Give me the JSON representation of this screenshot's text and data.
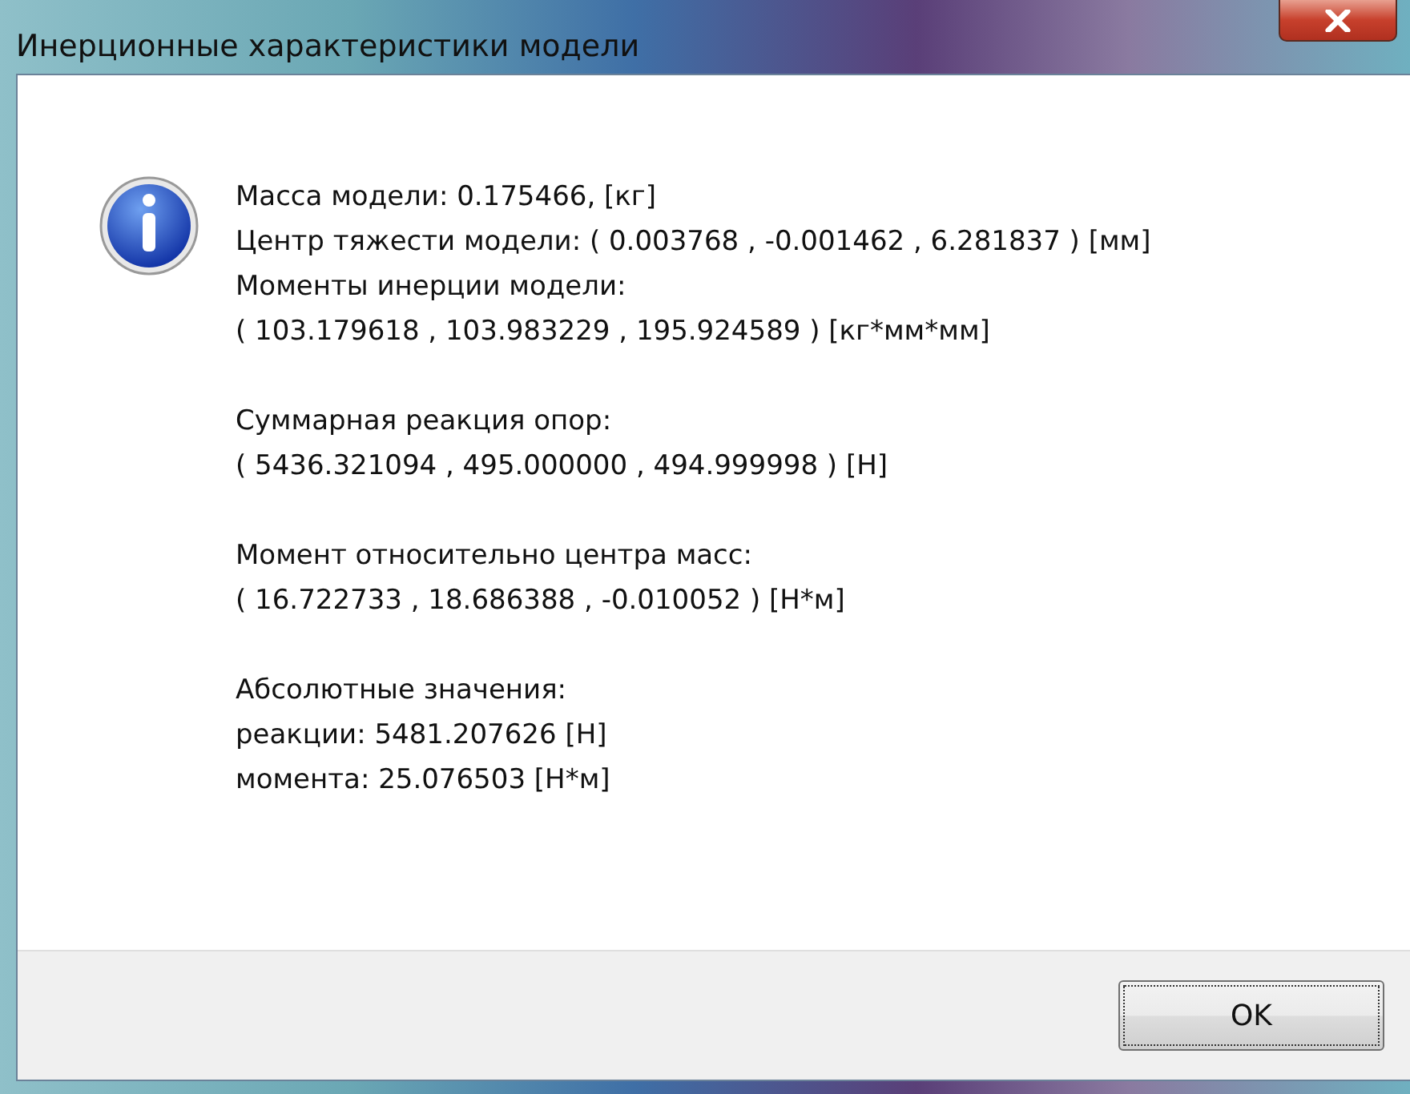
{
  "window": {
    "title": "Инерционные характеристики модели"
  },
  "message": {
    "groups": [
      [
        "Масса модели: 0.175466, [кг]",
        "Центр тяжести модели: ( 0.003768 , -0.001462 , 6.281837 ) [мм]",
        "Моменты инерции модели:",
        "( 103.179618 , 103.983229 , 195.924589 ) [кг*мм*мм]"
      ],
      [
        "Суммарная реакция опор:",
        "( 5436.321094 , 495.000000 , 494.999998 ) [Н]"
      ],
      [
        "Момент относительно центра масс:",
        "( 16.722733 , 18.686388 , -0.010052 ) [Н*м]"
      ],
      [
        "Абсолютные значения:",
        "реакции: 5481.207626 [Н]",
        "момента: 25.076503 [Н*м]"
      ]
    ]
  },
  "buttons": [
    {
      "label": "OK"
    }
  ]
}
